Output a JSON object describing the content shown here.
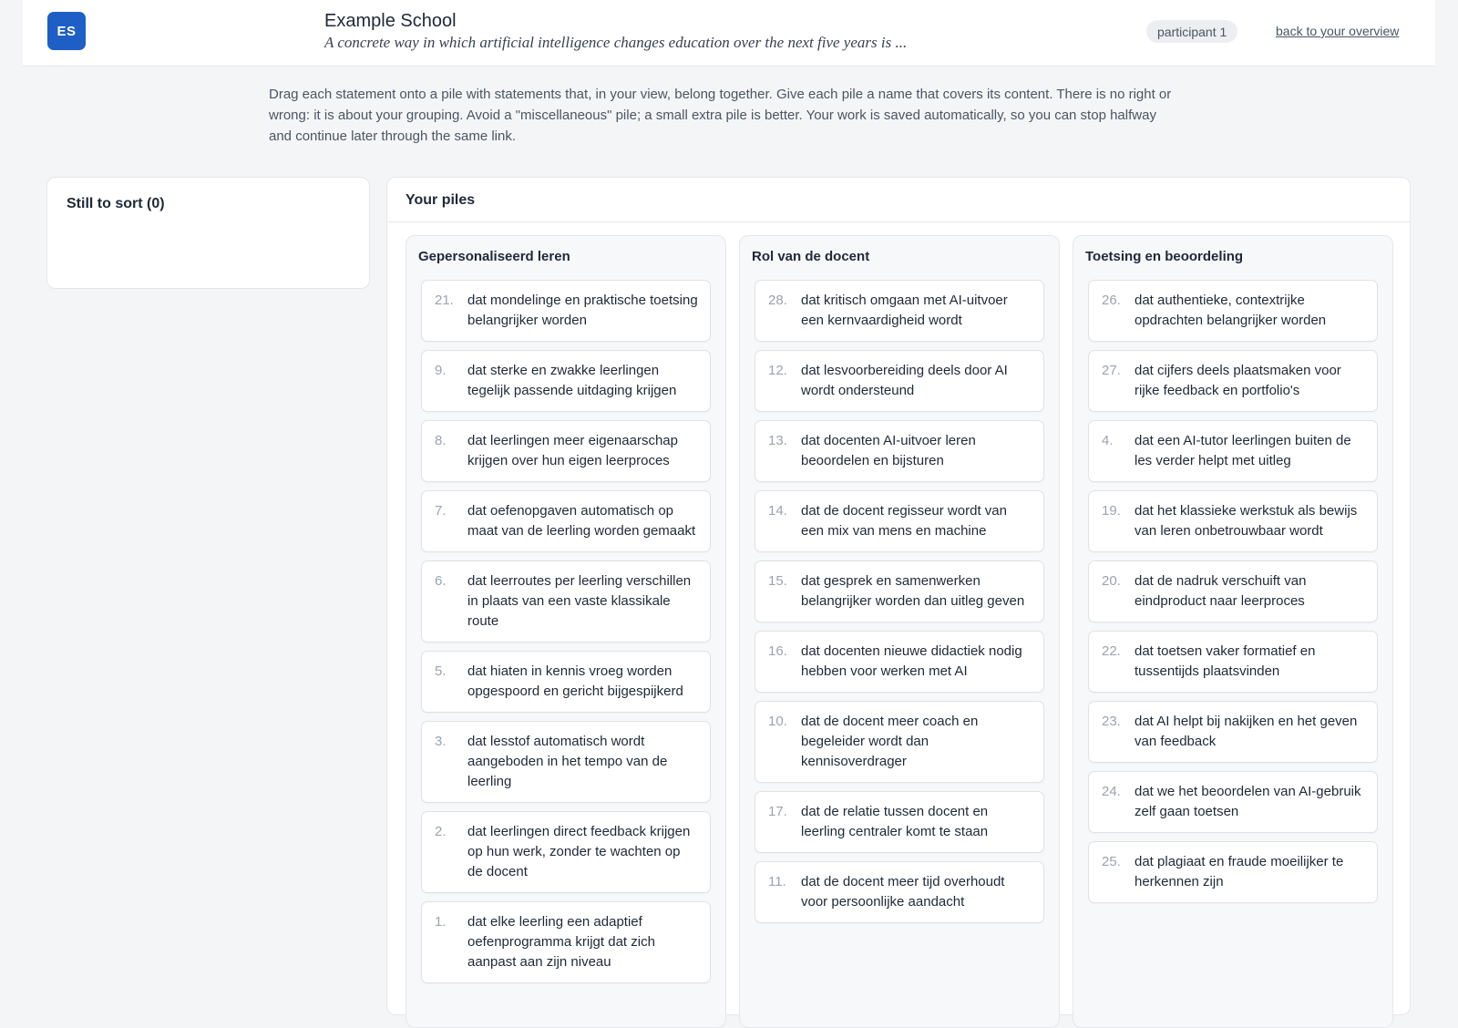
{
  "header": {
    "logo_text": "ES",
    "school_name": "Example School",
    "subtitle": "A concrete way in which artificial intelligence changes education over the next five years is ...",
    "participant": "participant 1",
    "back_link": "back to your overview"
  },
  "instructions": "Drag each statement onto a pile with statements that, in your view, belong together. Give each pile a name that covers its content. There is no right or wrong: it is about your grouping. Avoid a \"miscellaneous\" pile; a small extra pile is better. Your work is saved automatically, so you can stop halfway and continue later through the same link.",
  "unsorted": {
    "title": "Still to sort (0)"
  },
  "piles_title": "Your piles",
  "colors": {
    "accent": "#1d5fc4"
  },
  "piles": [
    {
      "name": "Gepersonaliseerd leren",
      "cards": [
        {
          "num": "21.",
          "text": "dat mondelinge en praktische toetsing belangrijker worden"
        },
        {
          "num": "9.",
          "text": "dat sterke en zwakke leerlingen tegelijk passende uitdaging krijgen"
        },
        {
          "num": "8.",
          "text": "dat leerlingen meer eigenaarschap krijgen over hun eigen leerproces"
        },
        {
          "num": "7.",
          "text": "dat oefenopgaven automatisch op maat van de leerling worden gemaakt"
        },
        {
          "num": "6.",
          "text": "dat leerroutes per leerling verschillen in plaats van een vaste klassikale route"
        },
        {
          "num": "5.",
          "text": "dat hiaten in kennis vroeg worden opgespoord en gericht bijgespijkerd"
        },
        {
          "num": "3.",
          "text": "dat lesstof automatisch wordt aangeboden in het tempo van de leerling"
        },
        {
          "num": "2.",
          "text": "dat leerlingen direct feedback krijgen op hun werk, zonder te wachten op de docent"
        },
        {
          "num": "1.",
          "text": "dat elke leerling een adaptief oefenprogramma krijgt dat zich aanpast aan zijn niveau"
        }
      ]
    },
    {
      "name": "Rol van de docent",
      "cards": [
        {
          "num": "28.",
          "text": "dat kritisch omgaan met AI-uitvoer een kernvaardigheid wordt"
        },
        {
          "num": "12.",
          "text": "dat lesvoorbereiding deels door AI wordt ondersteund"
        },
        {
          "num": "13.",
          "text": "dat docenten AI-uitvoer leren beoordelen en bijsturen"
        },
        {
          "num": "14.",
          "text": "dat de docent regisseur wordt van een mix van mens en machine"
        },
        {
          "num": "15.",
          "text": "dat gesprek en samenwerken belangrijker worden dan uitleg geven"
        },
        {
          "num": "16.",
          "text": "dat docenten nieuwe didactiek nodig hebben voor werken met AI"
        },
        {
          "num": "10.",
          "text": "dat de docent meer coach en begeleider wordt dan kennisoverdrager"
        },
        {
          "num": "17.",
          "text": "dat de relatie tussen docent en leerling centraler komt te staan"
        },
        {
          "num": "11.",
          "text": "dat de docent meer tijd overhoudt voor persoonlijke aandacht"
        }
      ]
    },
    {
      "name": "Toetsing en beoordeling",
      "cards": [
        {
          "num": "26.",
          "text": "dat authentieke, contextrijke opdrachten belangrijker worden"
        },
        {
          "num": "27.",
          "text": "dat cijfers deels plaatsmaken voor rijke feedback en portfolio's"
        },
        {
          "num": "4.",
          "text": "dat een AI-tutor leerlingen buiten de les verder helpt met uitleg"
        },
        {
          "num": "19.",
          "text": "dat het klassieke werkstuk als bewijs van leren onbetrouwbaar wordt"
        },
        {
          "num": "20.",
          "text": "dat de nadruk verschuift van eindproduct naar leerproces"
        },
        {
          "num": "22.",
          "text": "dat toetsen vaker formatief en tussentijds plaatsvinden"
        },
        {
          "num": "23.",
          "text": "dat AI helpt bij nakijken en het geven van feedback"
        },
        {
          "num": "24.",
          "text": "dat we het beoordelen van AI-gebruik zelf gaan toetsen"
        },
        {
          "num": "25.",
          "text": "dat plagiaat en fraude moeilijker te herkennen zijn"
        }
      ]
    }
  ]
}
